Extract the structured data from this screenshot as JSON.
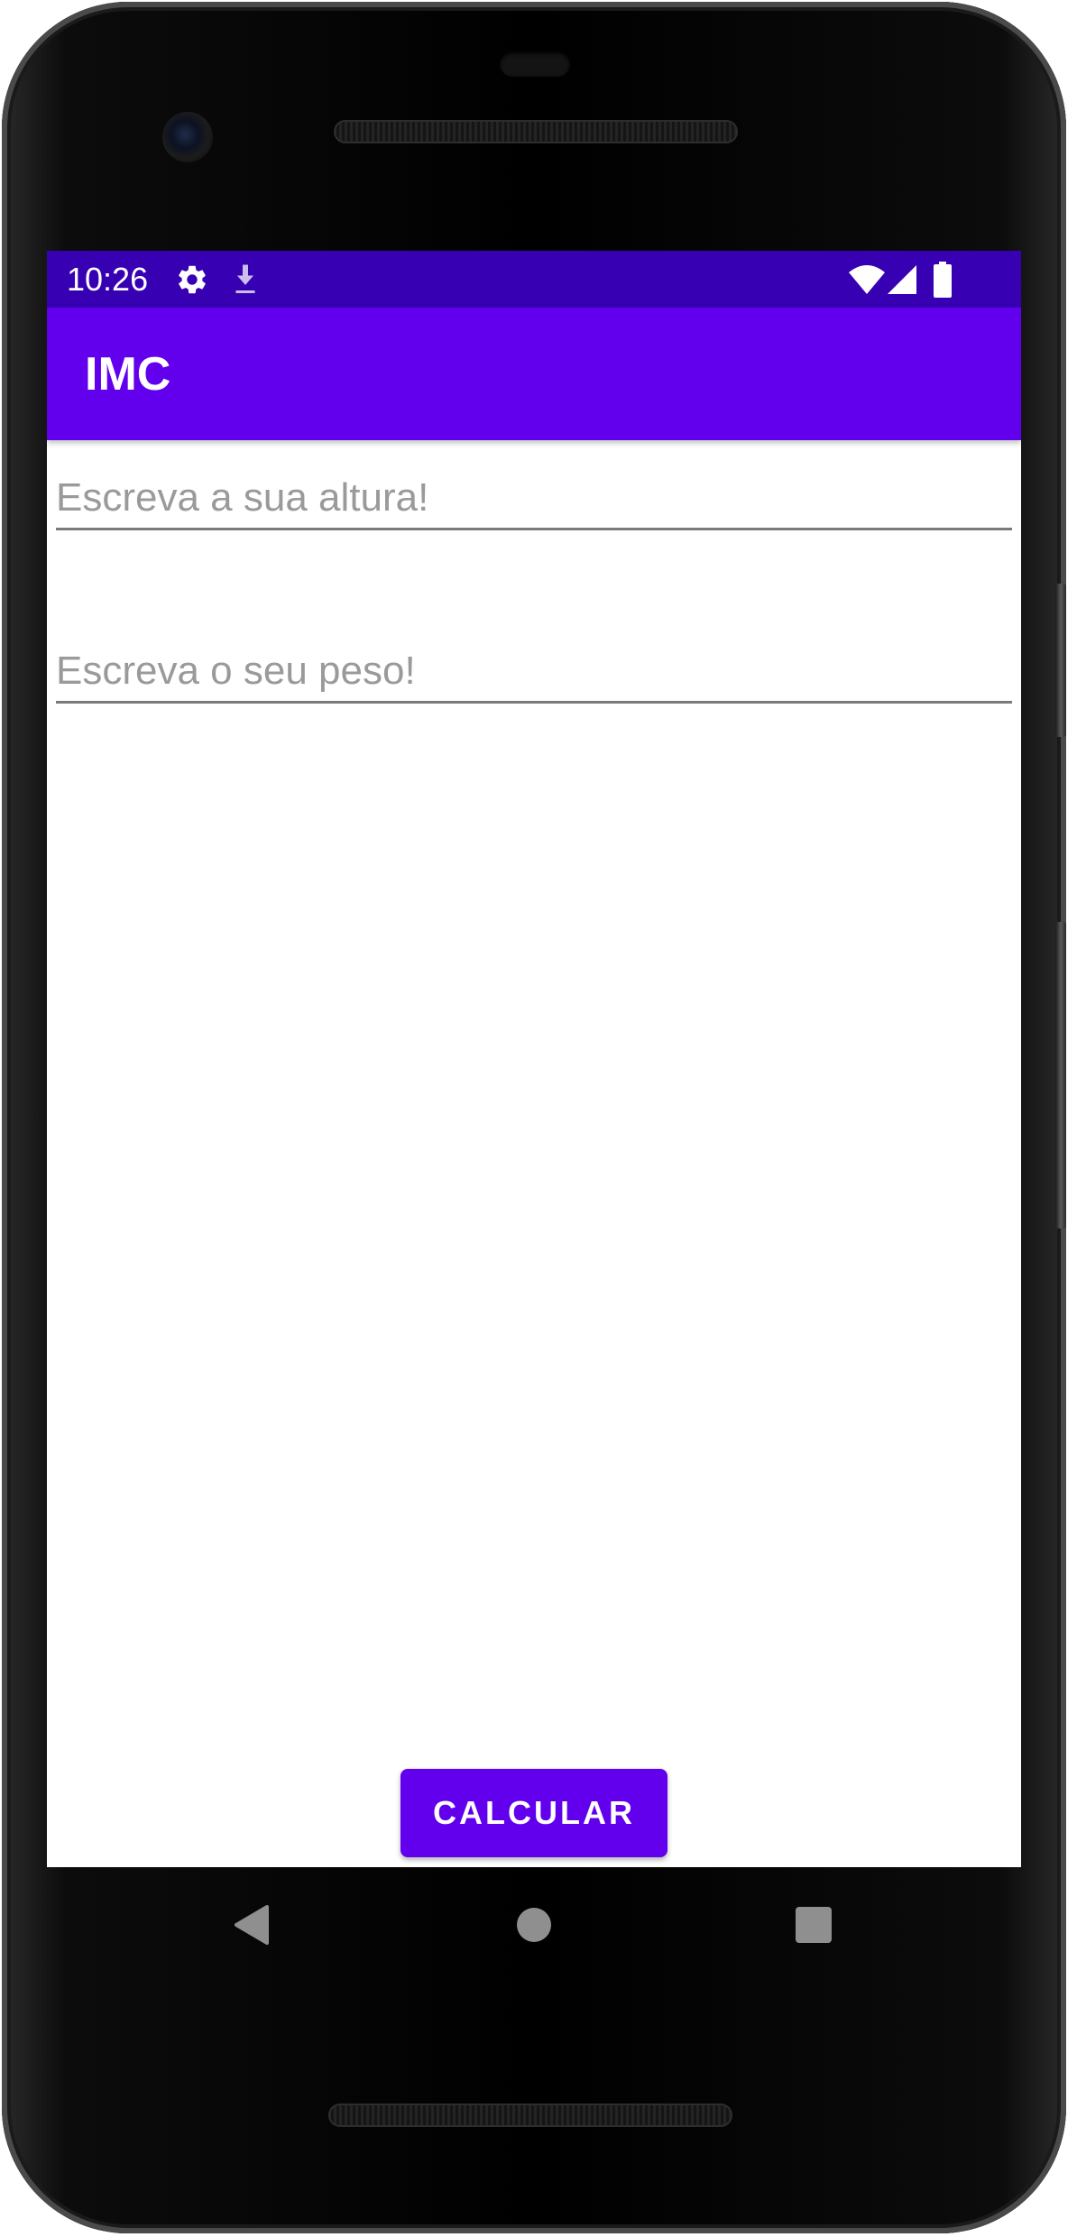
{
  "status_bar": {
    "time": "10:26",
    "icons": [
      "settings-icon",
      "download-icon",
      "wifi-icon",
      "signal-icon",
      "battery-icon"
    ]
  },
  "app_bar": {
    "title": "IMC"
  },
  "form": {
    "height_placeholder": "Escreva a sua altura!",
    "weight_placeholder": "Escreva o seu peso!"
  },
  "actions": {
    "calculate_label": "CALCULAR"
  },
  "nav_bar": {
    "icons": [
      "back-icon",
      "home-icon",
      "recents-icon"
    ]
  },
  "colors": {
    "primary": "#6200ee",
    "primary_dark": "#3700b3"
  }
}
